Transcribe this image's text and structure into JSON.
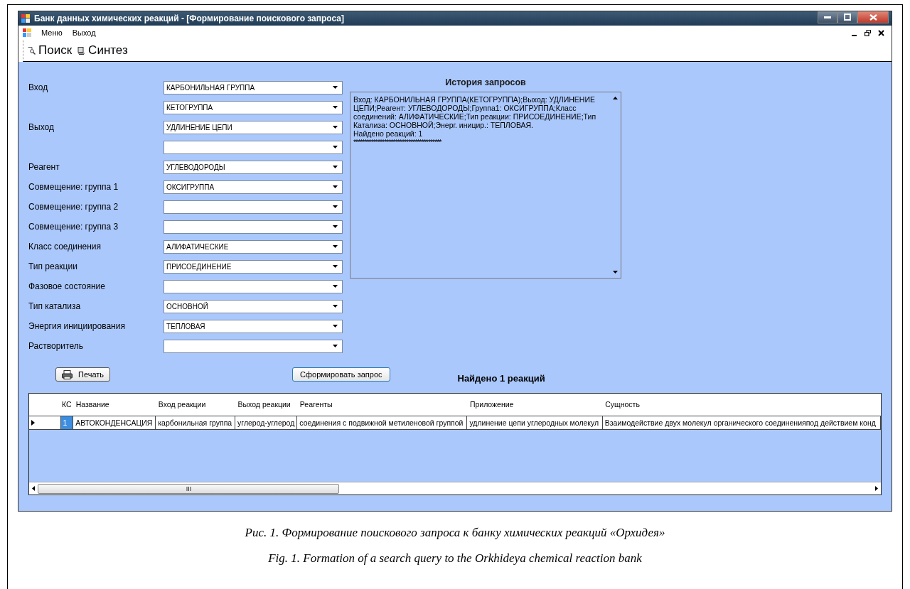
{
  "window": {
    "title": "Банк данных химических реакций - [Формирование поискового запроса]"
  },
  "menu": [
    "Меню",
    "Выход"
  ],
  "toolbar": [
    {
      "label": "Поиск",
      "kind": "search"
    },
    {
      "label": "Синтез",
      "kind": "synth"
    }
  ],
  "form": {
    "fields": [
      {
        "label": "Вход",
        "value": "КАРБОНИЛЬНАЯ ГРУППА"
      },
      {
        "value": "КЕТОГРУППА"
      },
      {
        "label": "Выход",
        "value": "УДЛИНЕНИЕ ЦЕПИ"
      },
      {
        "kind": "combo"
      },
      {
        "label": "Реагент",
        "value": "УГЛЕВОДОРОДЫ"
      },
      {
        "label": "Совмещение: группа 1",
        "value": "ОКСИГРУППА"
      },
      {
        "label": "Совмещение: группа 2"
      },
      {
        "label": "Совмещение: группа 3"
      },
      {
        "label": "Класс соединения",
        "value": "АЛИФАТИЧЕСКИЕ"
      },
      {
        "label": "Тип реакции",
        "value": "ПРИСОЕДИНЕНИЕ"
      },
      {
        "label": "Фазовое состояние"
      },
      {
        "label": "Тип катализа",
        "value": "ОСНОВНОЙ"
      },
      {
        "label": "Энергия инициирования",
        "value": "ТЕПЛОВАЯ"
      },
      {
        "label": "Растворитель"
      }
    ]
  },
  "history": {
    "title": "История запросов",
    "text": "Вход: КАРБОНИЛЬНАЯ ГРУППА(КЕТОГРУППА);Выход: УДЛИНЕНИЕ ЦЕПИ;Реагент: УГЛЕВОДОРОДЫ;Группа1: ОКСИГРУППА;Класс соединений: АЛИФАТИЧЕСКИЕ;Тип реакции: ПРИСОЕДИНЕНИЕ;Тип Катализа: ОСНОВНОЙ;Энерг. иницир.: ТЕПЛОВАЯ.",
    "found": "Найдено реакций: 1",
    "separator": "****************************************"
  },
  "buttons": {
    "print": "Печать",
    "build": "Сформировать запрос"
  },
  "result_title": "Найдено 1 реакций",
  "table": {
    "columns": [
      "КС",
      "Название",
      "Вход реакции",
      "Выход реакции",
      "Реагенты",
      "Приложение",
      "Сущность"
    ],
    "rows": [
      {
        "selected": true,
        "cells": [
          "1",
          "АВТОКОНДЕНСАЦИЯ",
          "карбонильная группа",
          "углерод-углерод",
          "соединения с подвижной метиленовой группой",
          "удлинение цепи углеродных молекул",
          "Взаимодействие двух молекул органического соединенияпод действием конд"
        ]
      }
    ]
  },
  "caption": [
    "Рис. 1. Формирование поискового запроса к банку химических реакций «Орхидея»",
    "Fig. 1. Formation of a search query to the Orkhideya chemical reaction bank"
  ]
}
